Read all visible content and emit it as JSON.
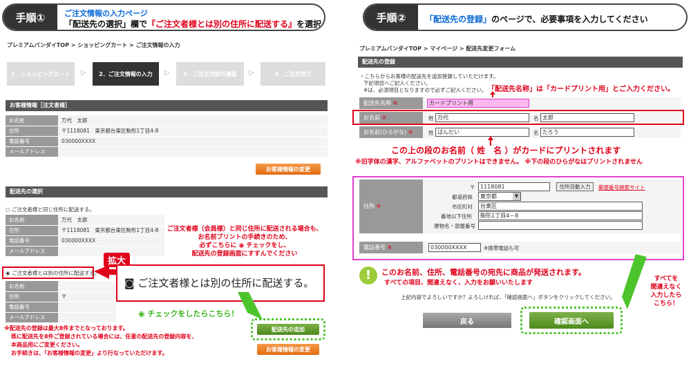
{
  "left": {
    "step_label": "手順①",
    "header_line1": "ご注文情報の入力ページ",
    "header_line2_a": "「配送先の選択」欄で",
    "header_line2_b": "『ご注文者様とは別の住所に配送する』",
    "header_line2_c": "を選択",
    "breadcrumb": "プレミアムバンダイTOP > ショッピングカート > ご注文情報の入力",
    "steps": [
      "1．ショッピングカート",
      "2．ご注文情報の入力",
      "3．ご注文内容の確認",
      "4．ご注文完了"
    ],
    "customer_section": "お客様情報［注文者様］",
    "customer_rows": [
      {
        "label": "お名前",
        "value": "万代　太郎"
      },
      {
        "label": "住所",
        "value": "〒1118081　東京都台東区駒形1丁目4-8"
      },
      {
        "label": "電話番号",
        "value": "030000XXXX"
      },
      {
        "label": "メールアドレス",
        "value": ""
      }
    ],
    "change_button": "お客様情報の変更",
    "delivery_section": "配送先の選択",
    "radio_same": "ご注文者様と同じ住所に配送する。",
    "delivery_rows": [
      {
        "label": "お名前",
        "value": "万代　太郎"
      },
      {
        "label": "住所",
        "value": "〒1118081　東京都台東区駒形1丁目4-8"
      },
      {
        "label": "電話番号",
        "value": "030000XXXX"
      },
      {
        "label": "メールアドレス",
        "value": ""
      }
    ],
    "note_lines": [
      "ご注文者様（会員様）と同じ住所に配送される場合も、",
      "お名前プリントの手続きのため、",
      "必ずこちらに ◉ チェックをし、",
      "配送先の登録画面にすすんでください"
    ],
    "zoom_label": "拡大",
    "radio_other_small": "ご注文者様とは別の住所に配送する。",
    "radio_other_big": "ご注文者様とは別の住所に配送する。",
    "other_rows": [
      {
        "label": "お名前",
        "value": ""
      },
      {
        "label": "住所",
        "value": "〒"
      },
      {
        "label": "電話番号",
        "value": ""
      },
      {
        "label": "メールアドレス",
        "value": ""
      }
    ],
    "check_here": "◉ チェックをしたらこちら！",
    "add_button": "配送先の追加",
    "footnotes": [
      "※配送先の登録は最大8件までとなっております。",
      "既に配送先を8件ご登録されている場合には、任意の配送先の登録内容を、",
      "本商品用にご変更ください。",
      "お手続きは、「お客様情報の変更」より行なっていただけます。"
    ],
    "change_button2": "お客様情報の変更"
  },
  "right": {
    "step_label": "手順②",
    "header_a": "「配送先の登録」",
    "header_b": "のページで、必要事項を入力してください",
    "breadcrumb": "プレミアムバンダイTOP > マイページ > 配送先変更フォーム",
    "section": "配送先の登録",
    "intro": [
      "・こちらからお客様の配送先を追加登録していただけます。",
      "下記項目へご記入ください。",
      "※は、必須項目となりますので必ずご記入ください。"
    ],
    "print_note": "「配送先名称」は「カードプリント用」とご入力ください。",
    "fields": {
      "dest_label": "配送先名称",
      "dest_value": "カードプリント用",
      "name_label": "お名前",
      "sei": "姓",
      "mei": "名",
      "sei_value": "万代",
      "mei_value": "太郎",
      "kana_label": "お名前(ひらがな)",
      "sei_kana": "ばんだい",
      "mei_kana": "たろう",
      "required_mark": "※",
      "address_label": "住所",
      "zip_mark": "〒",
      "zip_value": "1118081",
      "auto_button": "住所自動入力",
      "zip_link": "郵便番号検索サイト",
      "pref_label": "都道府県",
      "pref_value": "東京都",
      "city_label": "市区町村",
      "city_value": "台東区",
      "street_label": "番地以下住所",
      "street_value": "駒形1丁目4－8",
      "building_label": "建物名・部屋番号",
      "phone_label": "電話番号",
      "phone_value": "030000XXXX",
      "phone_note": "※携帯電話も可"
    },
    "print_big": "この上の段のお名前（ 姓　名 ）がカードにプリントされます",
    "print_warn": "※旧字体の漢字、アルファベットのプリントはできません。 ※下の段のひらがなはプリントされません",
    "exclaim": "!",
    "ship_note": "このお名前、住所、電話番号の宛先に商品が発送されます。",
    "ship_sub": "すべての項目、間違えなく、入力をお願いいたします",
    "side_note": [
      "すべてを",
      "間違えなく",
      "入力したら",
      "こちら！"
    ],
    "confirm_text": "上記内容でよろしいですか？よろしければ、「確認画面へ」ボタンをクリックしてください。",
    "back_button": "戻る",
    "confirm_button": "確認画面へ"
  },
  "colors": {
    "accent_red": "#e0001a",
    "accent_blue": "#0a6ad8",
    "accent_green": "#4cc42c",
    "orange": "#e26a10",
    "magenta": "#e040d0"
  }
}
